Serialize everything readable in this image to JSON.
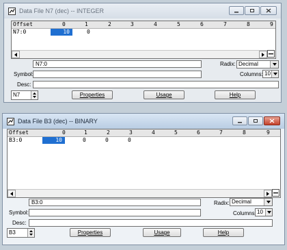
{
  "windows": [
    {
      "title": "Data File N7 (dec)  --  INTEGER",
      "grid_header": [
        "Offset",
        "0",
        "1",
        "2",
        "3",
        "4",
        "5",
        "6",
        "7",
        "8",
        "9"
      ],
      "rows": [
        {
          "offset": "N7:0",
          "cells": [
            "10",
            "0"
          ]
        }
      ],
      "address": "N7:0",
      "symbol": "",
      "desc": "",
      "radix_label": "Radix:",
      "radix_value": "Decimal",
      "columns_label": "Columns:",
      "columns_value": "10",
      "symbol_label": "Symbol:",
      "desc_label": "Desc:",
      "file_spinner": "N7",
      "properties_label": "Properties",
      "usage_label": "Usage",
      "help_label": "Help"
    },
    {
      "title": "Data File B3 (dec)  --  BINARY",
      "grid_header": [
        "Offset",
        "0",
        "1",
        "2",
        "3",
        "4",
        "5",
        "6",
        "7",
        "8",
        "9"
      ],
      "rows": [
        {
          "offset": "B3:0",
          "cells": [
            "10",
            "0",
            "0",
            "0"
          ]
        }
      ],
      "address": "B3:0",
      "symbol": "",
      "desc": "",
      "radix_label": "Radix:",
      "radix_value": "Decimal",
      "columns_label": "Columns:",
      "columns_value": "10",
      "symbol_label": "Symbol:",
      "desc_label": "Desc:",
      "file_spinner": "B3",
      "properties_label": "Properties",
      "usage_label": "Usage",
      "help_label": "Help"
    }
  ],
  "colors": {
    "selected_cell": "#1f6fd1",
    "active_titlebar": "#b9cde3",
    "close_button": "#c4412a"
  }
}
